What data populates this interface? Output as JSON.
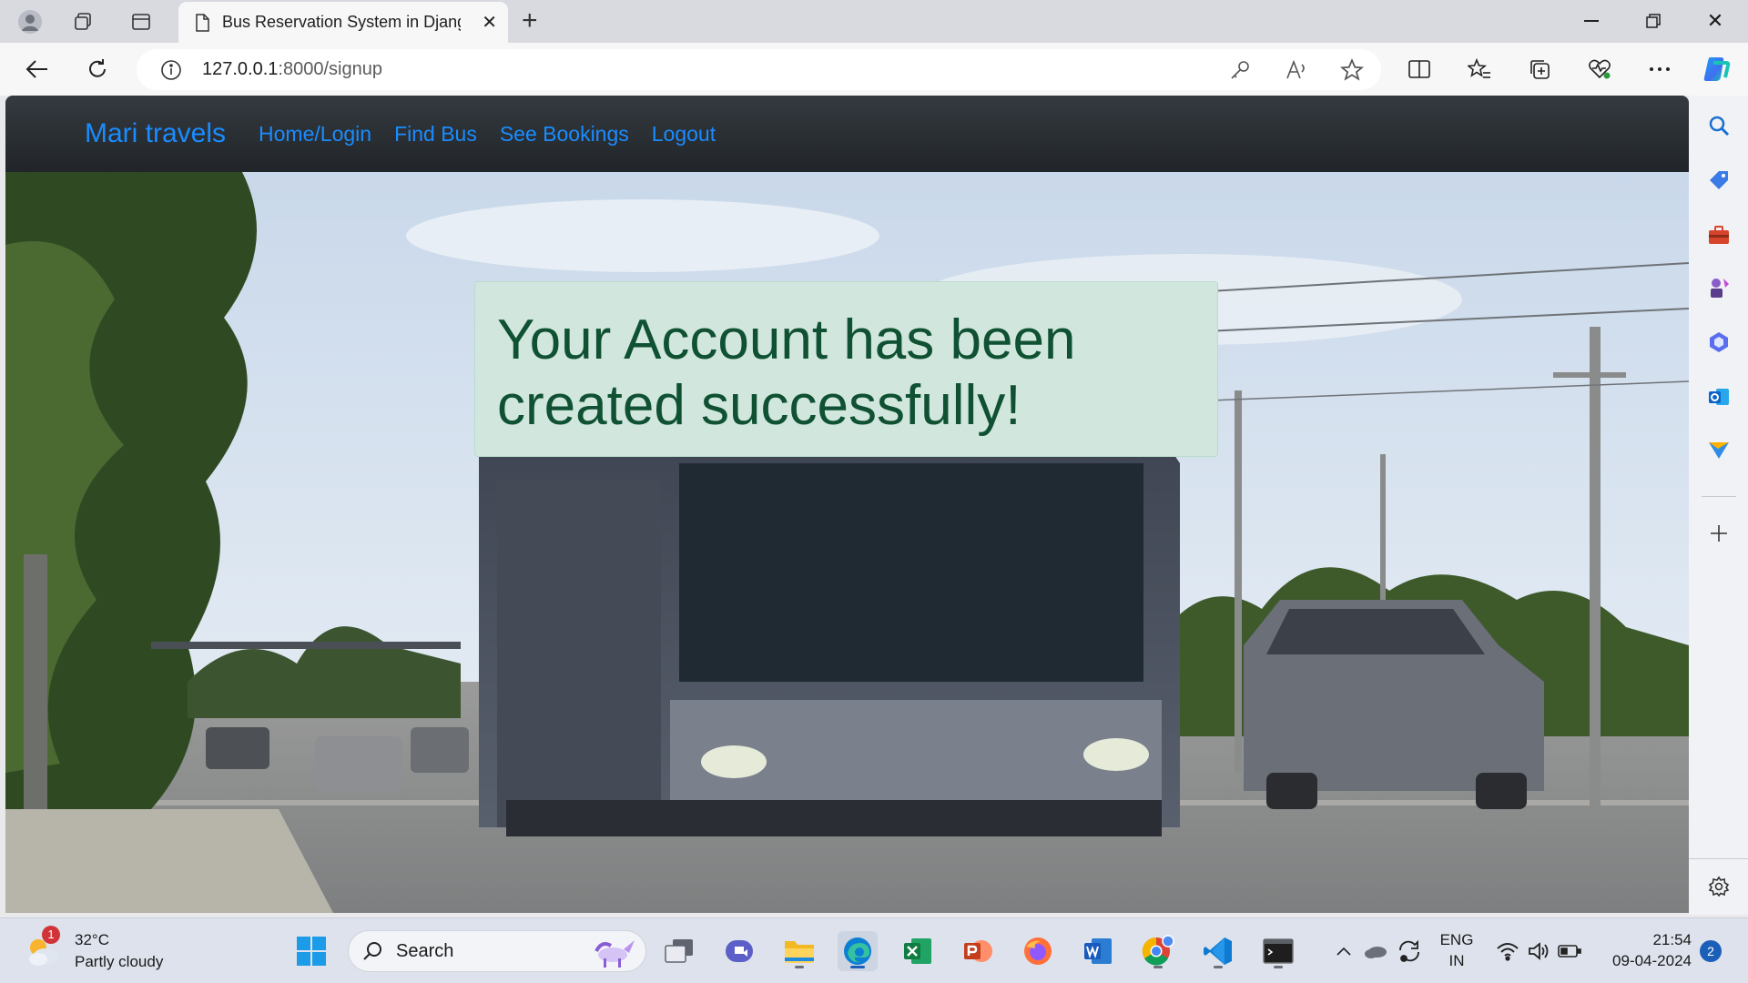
{
  "browser": {
    "tab_title": "Bus Reservation System in Djang",
    "url_host": "127.0.0.1",
    "url_path": ":8000/signup"
  },
  "navbar": {
    "brand": "Mari travels",
    "links": [
      "Home/Login",
      "Find Bus",
      "See Bookings",
      "Logout"
    ]
  },
  "alert": {
    "message": "Your Account has been created successfully!",
    "colors": {
      "background": "#d1e7dd",
      "text": "#0f5132"
    }
  },
  "taskbar": {
    "weather": {
      "temp": "32°C",
      "condition": "Partly cloudy",
      "badge": "1"
    },
    "search_label": "Search",
    "lang_line1": "ENG",
    "lang_line2": "IN",
    "time": "21:54",
    "date": "09-04-2024",
    "notifications": "2",
    "apps": [
      "start-icon",
      "search-icon",
      "task-view-icon",
      "teams-icon",
      "file-explorer-icon",
      "edge-icon",
      "excel-icon",
      "powerpoint-icon",
      "firefox-icon",
      "word-icon",
      "chrome-icon",
      "vscode-icon",
      "terminal-icon"
    ]
  },
  "theme": {
    "link_color": "#1a8cff",
    "navbar_bg": "#212529"
  }
}
